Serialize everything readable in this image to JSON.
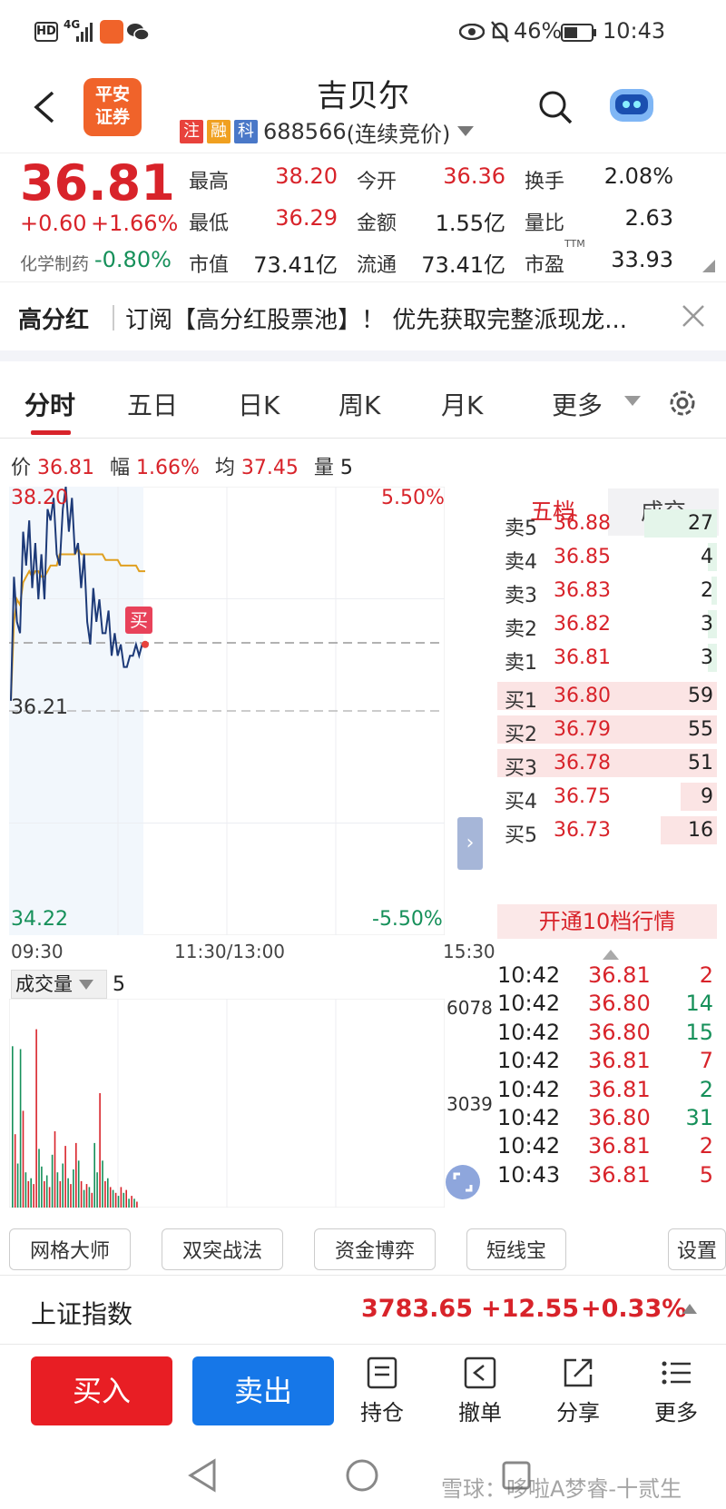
{
  "status": {
    "network": "4G",
    "battery": "46%",
    "time": "10:43",
    "hd": "HD"
  },
  "header": {
    "title": "吉贝尔",
    "badges": [
      "注",
      "融",
      "科"
    ],
    "code": "688566",
    "market_state": "(连续竞价)",
    "logo_line1": "平安",
    "logo_line2": "证券"
  },
  "quote": {
    "price": "36.81",
    "change": "+0.60",
    "change_pct": "+1.66%",
    "sector_name": "化学制药",
    "sector_pct": "-0.80%",
    "fields": [
      {
        "label": "最高",
        "value": "38.20"
      },
      {
        "label": "今开",
        "value": "36.36"
      },
      {
        "label": "换手",
        "value": "2.08%"
      },
      {
        "label": "最低",
        "value": "36.29"
      },
      {
        "label": "金额",
        "value": "1.55亿"
      },
      {
        "label": "量比",
        "value": "2.63"
      },
      {
        "label": "市值",
        "value": "73.41亿"
      },
      {
        "label": "流通",
        "value": "73.41亿"
      },
      {
        "label": "市盈",
        "value": "33.93"
      }
    ],
    "pe_superscript": "TTM"
  },
  "banner": {
    "tag": "高分红",
    "text": "订阅【高分红股票池】！ 优先获取完整派现龙..."
  },
  "tabs": [
    "分时",
    "五日",
    "日K",
    "周K",
    "月K",
    "更多"
  ],
  "chart_info": {
    "price_label": "价",
    "price": "36.81",
    "amp_label": "幅",
    "amp": "1.66%",
    "avg_label": "均",
    "avg": "37.45",
    "vol_label": "量",
    "vol": "5"
  },
  "chart_axis": {
    "y_top": "38.20",
    "y_mid": "36.21",
    "y_bottom": "34.22",
    "pct_top": "5.50%",
    "pct_bottom": "-5.50%",
    "x_start": "09:30",
    "x_mid": "11:30/13:00",
    "x_end": "15:30",
    "buy_marker": "买"
  },
  "volume": {
    "label": "成交量",
    "value": "5",
    "y1": "6078",
    "y2": "3039"
  },
  "chart_data": {
    "type": "line",
    "ylim": [
      34.22,
      38.2
    ],
    "series": [
      {
        "values": [
          36.3,
          37.4,
          37.0,
          36.9,
          37.8,
          37.5,
          37.9,
          37.3,
          37.7,
          37.2,
          37.6,
          37.2,
          38.0,
          37.9,
          38.1,
          37.6,
          37.5,
          38.0,
          38.2,
          37.8,
          38.1,
          37.6,
          37.7,
          37.3,
          37.6,
          37.0,
          36.8,
          37.3,
          37.0,
          37.2,
          36.9,
          36.9,
          37.1,
          36.7,
          36.9,
          36.7,
          36.8,
          36.6,
          36.6,
          36.7,
          36.7,
          36.8,
          36.7,
          36.8,
          36.8
        ]
      },
      {
        "values": [
          36.3,
          37.0,
          37.2,
          37.15,
          37.35,
          37.4,
          37.45,
          37.4,
          37.45,
          37.45,
          37.4,
          37.4,
          37.45,
          37.5,
          37.5,
          37.5,
          37.6,
          37.6,
          37.6,
          37.6,
          37.6,
          37.6,
          37.65,
          37.6,
          37.6,
          37.6,
          37.6,
          37.6,
          37.6,
          37.6,
          37.6,
          37.55,
          37.55,
          37.55,
          37.55,
          37.55,
          37.5,
          37.5,
          37.5,
          37.5,
          37.5,
          37.5,
          37.45,
          37.45,
          37.45
        ]
      }
    ],
    "volume_bars": [
      {
        "v": 5500,
        "c": "g"
      },
      {
        "v": 2500,
        "c": "r"
      },
      {
        "v": 1500,
        "c": "g"
      },
      {
        "v": 5400,
        "c": "g"
      },
      {
        "v": 3300,
        "c": "r"
      },
      {
        "v": 1200,
        "c": "g"
      },
      {
        "v": 900,
        "c": "r"
      },
      {
        "v": 1000,
        "c": "g"
      },
      {
        "v": 800,
        "c": "r"
      },
      {
        "v": 6078,
        "c": "r"
      },
      {
        "v": 2000,
        "c": "g"
      },
      {
        "v": 1400,
        "c": "g"
      },
      {
        "v": 900,
        "c": "r"
      },
      {
        "v": 1100,
        "c": "g"
      },
      {
        "v": 700,
        "c": "r"
      },
      {
        "v": 1800,
        "c": "g"
      },
      {
        "v": 2600,
        "c": "r"
      },
      {
        "v": 1200,
        "c": "g"
      },
      {
        "v": 900,
        "c": "r"
      },
      {
        "v": 1500,
        "c": "g"
      },
      {
        "v": 2100,
        "c": "r"
      },
      {
        "v": 1000,
        "c": "g"
      },
      {
        "v": 800,
        "c": "r"
      },
      {
        "v": 1300,
        "c": "g"
      },
      {
        "v": 2200,
        "c": "r"
      },
      {
        "v": 1600,
        "c": "g"
      },
      {
        "v": 900,
        "c": "r"
      },
      {
        "v": 600,
        "c": "g"
      },
      {
        "v": 800,
        "c": "r"
      },
      {
        "v": 700,
        "c": "g"
      },
      {
        "v": 500,
        "c": "r"
      },
      {
        "v": 2200,
        "c": "g"
      },
      {
        "v": 1200,
        "c": "g"
      },
      {
        "v": 3900,
        "c": "r"
      },
      {
        "v": 1600,
        "c": "g"
      },
      {
        "v": 900,
        "c": "r"
      },
      {
        "v": 1000,
        "c": "g"
      },
      {
        "v": 700,
        "c": "r"
      },
      {
        "v": 600,
        "c": "g"
      },
      {
        "v": 500,
        "c": "r"
      },
      {
        "v": 400,
        "c": "g"
      },
      {
        "v": 700,
        "c": "r"
      },
      {
        "v": 500,
        "c": "g"
      },
      {
        "v": 600,
        "c": "r"
      },
      {
        "v": 300,
        "c": "g"
      },
      {
        "v": 400,
        "c": "r"
      },
      {
        "v": 300,
        "c": "g"
      },
      {
        "v": 200,
        "c": "r"
      }
    ]
  },
  "orderbook": {
    "tab_five": "五档",
    "tab_trades": "成交",
    "asks": [
      {
        "label": "卖5",
        "price": "36.88",
        "qty": "27"
      },
      {
        "label": "卖4",
        "price": "36.85",
        "qty": "4"
      },
      {
        "label": "卖3",
        "price": "36.83",
        "qty": "2"
      },
      {
        "label": "卖2",
        "price": "36.82",
        "qty": "3"
      },
      {
        "label": "卖1",
        "price": "36.81",
        "qty": "3"
      }
    ],
    "bids": [
      {
        "label": "买1",
        "price": "36.80",
        "qty": "59"
      },
      {
        "label": "买2",
        "price": "36.79",
        "qty": "55"
      },
      {
        "label": "买3",
        "price": "36.78",
        "qty": "51"
      },
      {
        "label": "买4",
        "price": "36.75",
        "qty": "9"
      },
      {
        "label": "买5",
        "price": "36.73",
        "qty": "16"
      }
    ],
    "level10": "开通10档行情"
  },
  "trades": [
    {
      "t": "10:42",
      "p": "36.81",
      "q": "2",
      "c": "red"
    },
    {
      "t": "10:42",
      "p": "36.80",
      "q": "14",
      "c": "green"
    },
    {
      "t": "10:42",
      "p": "36.80",
      "q": "15",
      "c": "green"
    },
    {
      "t": "10:42",
      "p": "36.81",
      "q": "7",
      "c": "red"
    },
    {
      "t": "10:42",
      "p": "36.81",
      "q": "2",
      "c": "green"
    },
    {
      "t": "10:42",
      "p": "36.80",
      "q": "31",
      "c": "green"
    },
    {
      "t": "10:42",
      "p": "36.81",
      "q": "2",
      "c": "red"
    },
    {
      "t": "10:43",
      "p": "36.81",
      "q": "5",
      "c": "red"
    }
  ],
  "tools": [
    "网格大师",
    "双突战法",
    "资金博弈",
    "短线宝",
    "设置"
  ],
  "index": {
    "name": "上证指数",
    "value": "3783.65",
    "change": "+12.55",
    "pct": "+0.33%"
  },
  "bottom": {
    "buy": "买入",
    "sell": "卖出",
    "hold": "持仓",
    "cancel": "撤单",
    "share": "分享",
    "more": "更多"
  },
  "watermark": "雪球：哆啦A梦睿-十贰生",
  "colors": {
    "red": "#d8232a",
    "green": "#16905a",
    "blue": "#1677e8",
    "orange": "#f0632a"
  }
}
